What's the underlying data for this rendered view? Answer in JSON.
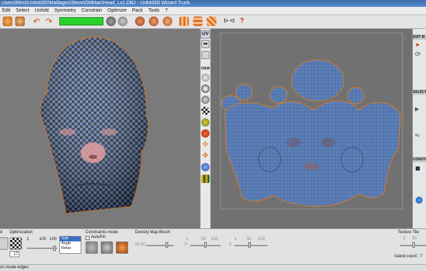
{
  "window": {
    "title": "Users\\Rémi\\Unfold3D\\Maillages\\Steve\\OldMan\\Head_Lv1.OBJ - Unfold3D Wizard Trunk"
  },
  "menu": [
    "Edit",
    "Select",
    "Unfold",
    "Symmetry",
    "Constrain",
    "Optimize",
    "Pack",
    "Tools",
    "?"
  ],
  "side_toolbar": {
    "uv_label": "UV",
    "view_label": "VIEW"
  },
  "right_panel": {
    "edit_label": "EDIT M",
    "select_label": "SELECT",
    "constraints_label": "CONSTI"
  },
  "bottom": {
    "left_fragment": "d",
    "optimization": {
      "label": "Optimization",
      "tick_min": "1",
      "tick_mid": "100",
      "tick_max": "100",
      "iterations": "17",
      "modes": [
        "Soft",
        "Angle",
        "Relax"
      ],
      "selected_mode": "Soft"
    },
    "constraints": {
      "label": "Constraints mode",
      "autopin_label": "AutoPin"
    },
    "density": {
      "label": "Density Map Brush",
      "value_fragment": "x2.00",
      "p_label": "P",
      "s_label": "S",
      "tick1": "1",
      "tick50": "50",
      "tick100": "100"
    },
    "texture": {
      "label": "Texture Tile",
      "tick1": "1",
      "tick50": "50",
      "island_count": "Island count : 7"
    }
  },
  "status": {
    "text": "on mode edges"
  },
  "colors": {
    "green_progress": "#2bd12b",
    "viewport_bg": "#777777",
    "mesh_blue": "#5b7fb8",
    "uv_edge_orange": "#e07a20"
  }
}
